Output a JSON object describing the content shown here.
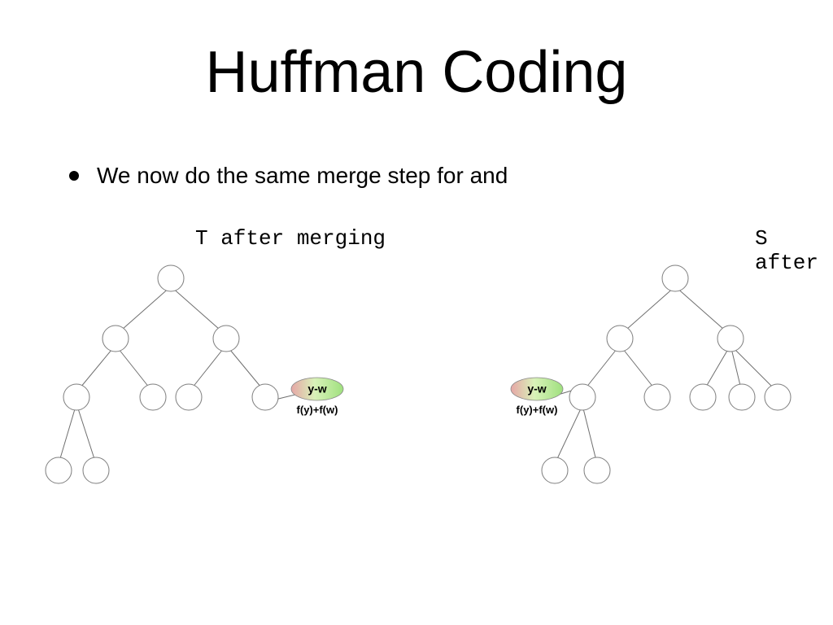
{
  "title": "Huffman Coding",
  "bullet": "We now do the same merge step for  and",
  "captions": {
    "t": "T after merging",
    "s": "S after"
  },
  "merge": {
    "node_label": "y-w",
    "freq_label": "f(y)+f(w)"
  }
}
